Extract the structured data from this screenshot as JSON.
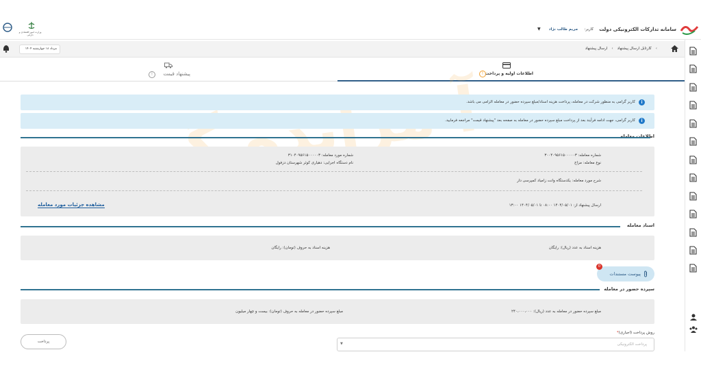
{
  "header": {
    "system_title": "سامانه تدارکات الکترونیکی دولت",
    "user_label": "کاربر:",
    "user_name": "مریم طالب نژاد",
    "left_logo_caption": "وزارت امور اقتصادی و دارایی"
  },
  "subbar": {
    "breadcrumb_1": "کارتابل ارسال پیشنهاد",
    "breadcrumb_sep": "›",
    "breadcrumb_2": "ارسال پیشنهاد",
    "date": "مرداد ۱۸ چهارشنبه ۱۴۰۴"
  },
  "tabs": {
    "initial_info": "اطلاعات اولیه و پرداخت",
    "price_offer": "پیشنهاد قیمت",
    "badge": "!"
  },
  "alerts": {
    "alert_1": "کاربر گرامی به منظور شرکت در معامله، پرداخت هزینه اسناد/مبلغ سپرده حضور در معامله الزامی می باشد.",
    "alert_2": "کاربر گرامی، جهت ادامه فرآیند بعد از پرداخت مبلغ سپرده حضور در معامله به صفحه بعد \"پیشنهاد قیمت\" مراجعه فرمایید."
  },
  "deal_info": {
    "section_title": "اطلاعات معامله",
    "deal_number": "شماره معامله: ۳۰۰۴۰۹۵۶۱۵۰۰۰۰۰۳",
    "deal_type": "نوع معامله: مزاج",
    "item_number": "شماره مورد معامله: ۳۱۰۴۰۹۵۶۱۵۰۰۰۰۰۳",
    "executor": "نام دستگاه اجرایی: دهیاری کوثر شهرستان دزفول",
    "description": "شرح مورد معامله: یکدستگاه وانت زامیاد کمپرسی دار",
    "send_period": "ارسال پیشنهاد از: ۱۴۰۴/۰۵/۰۱ ۰۸:۰۰ تا ۱۴۰۴/۰۵/۰۱ ۱۳:۰۰",
    "view_details_link": "مشاهده جزئیات مورد معامله"
  },
  "documents": {
    "section_title": "اسناد معامله",
    "cost_numeric": "هزینه اسناد به عدد (ریال): رایگان",
    "cost_letters": "هزینه اسناد به حروف (تومان): رایگان",
    "attachments_button": "پیوست مستندات",
    "attachments_count": "0"
  },
  "deposit": {
    "section_title": "سپرده حضور در معامله",
    "amount_numeric": "مبلغ سپرده حضور در معامله به عدد (ریال): ۲۴۰،۰۰۰،۰۰۰",
    "amount_letters": "مبلغ سپرده حضور در معامله به حروف (تومان): بیست و چهار میلیون"
  },
  "payment": {
    "method_label": "روش پرداخت (اجباری)",
    "required_mark": "*",
    "method_placeholder": "پرداخت الکترونیکی",
    "pay_button": "پرداخت"
  },
  "watermark": "آ مزایده گر",
  "colors": {
    "accent": "#2f5d88",
    "info_bg": "#d9edf7",
    "info_icon": "#1f78c8",
    "section_line": "#2f7290",
    "link": "#1f5f9e",
    "attach_bg": "#cfe6f3",
    "badge": "#d9342b",
    "tab_badge": "#f0a030",
    "watermark_orange": "#f6b65a",
    "watermark_gray": "#d6d6d6",
    "logo_red": "#e03b3b",
    "logo_green": "#2d9a4a"
  }
}
